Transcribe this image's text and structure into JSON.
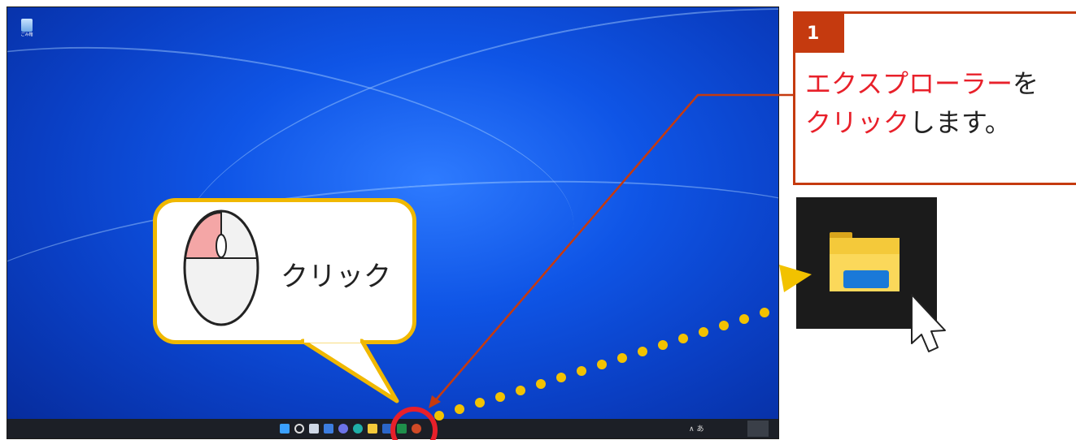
{
  "desktop": {
    "recycle_bin_label": "ごみ箱",
    "taskbar": {
      "icons": [
        "start-icon",
        "search-icon",
        "task-view-icon",
        "widgets-icon",
        "chat-icon",
        "edge-icon",
        "file-explorer-icon",
        "word-icon",
        "excel-icon",
        "powerpoint-icon"
      ],
      "tray_text": "∧ あ"
    }
  },
  "callout": {
    "step_number": "1",
    "line1_highlight": "エクスプローラー",
    "line1_rest": "を",
    "line2_highlight": "クリック",
    "line2_rest": "します。"
  },
  "bubble": {
    "text": "クリック"
  },
  "colors": {
    "accent": "#c53a0f",
    "highlight": "#e8202a",
    "bubble_border": "#f0b800",
    "desktop_blue": "#0a3fc4"
  }
}
